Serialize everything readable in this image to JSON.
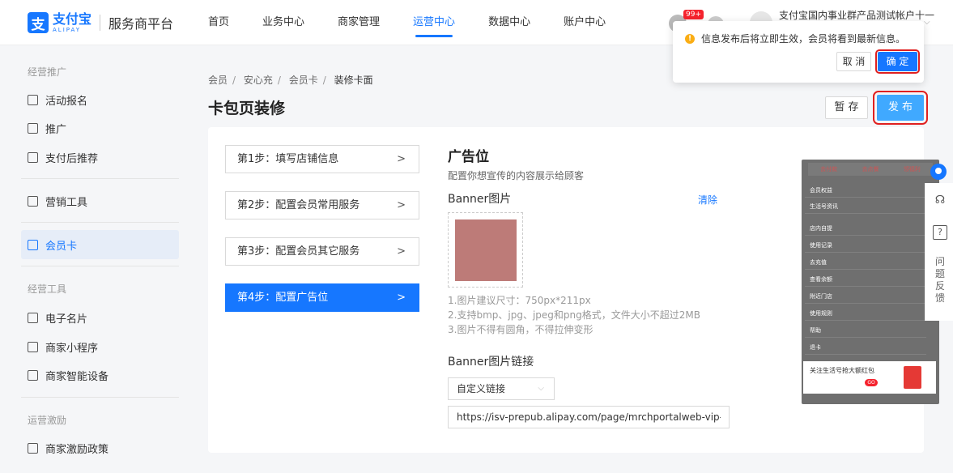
{
  "header": {
    "logo_cn": "支付宝",
    "logo_en": "ALIPAY",
    "platform": "服务商平台",
    "nav": [
      "首页",
      "业务中心",
      "商家管理",
      "运营中心",
      "数据中心",
      "账户中心"
    ],
    "active_nav": "运营中心",
    "badge": "99+",
    "account_name": "支付宝国内事业群产品测试帐户十一"
  },
  "popconfirm": {
    "message": "信息发布后将立即生效，会员将看到最新信息。",
    "cancel": "取 消",
    "ok": "确 定"
  },
  "sidebar": {
    "group1": "经营推广",
    "item_activity": "活动报名",
    "item_promote": "推广",
    "item_after_pay": "支付后推荐",
    "item_marketing": "营销工具",
    "item_member_card": "会员卡",
    "group2": "经营工具",
    "item_ecard": "电子名片",
    "item_miniapp": "商家小程序",
    "item_device": "商家智能设备",
    "group3": "运营激励",
    "item_policy": "商家激励政策"
  },
  "breadcrumb": [
    "会员",
    "安心充",
    "会员卡",
    "装修卡面"
  ],
  "page_title": "卡包页装修",
  "actions": {
    "save": "暂 存",
    "publish": "发 布"
  },
  "steps": [
    "第1步：填写店铺信息",
    "第2步：配置会员常用服务",
    "第3步：配置会员其它服务",
    "第4步：配置广告位"
  ],
  "form": {
    "section_title": "广告位",
    "section_sub": "配置你想宣传的内容展示给顾客",
    "banner_label": "Banner图片",
    "clear": "清除",
    "hints": [
      "1.图片建议尺寸：750px*211px",
      "2.支持bmp、jpg、jpeg和png格式，文件大小不超过2MB",
      "3.图片不得有圆角，不得拉伸变形"
    ],
    "link_label": "Banner图片链接",
    "link_type": "自定义链接",
    "link_url": "https://isv-prepub.alipay.com/page/mrchportalweb-vip-"
  },
  "preview": {
    "tabs": [
      "去付款",
      "去点餐",
      "领福利"
    ],
    "rows": [
      "会员权益",
      "生活号资讯",
      "店内自提",
      "使用记录",
      "去充值",
      "查看余额",
      "附近门店",
      "使用规则",
      "帮助",
      "退卡"
    ],
    "ad_title": "关注生活号抢大额红包",
    "ad_go": "GO"
  },
  "float_bar": {
    "feedback": "问题反馈"
  }
}
